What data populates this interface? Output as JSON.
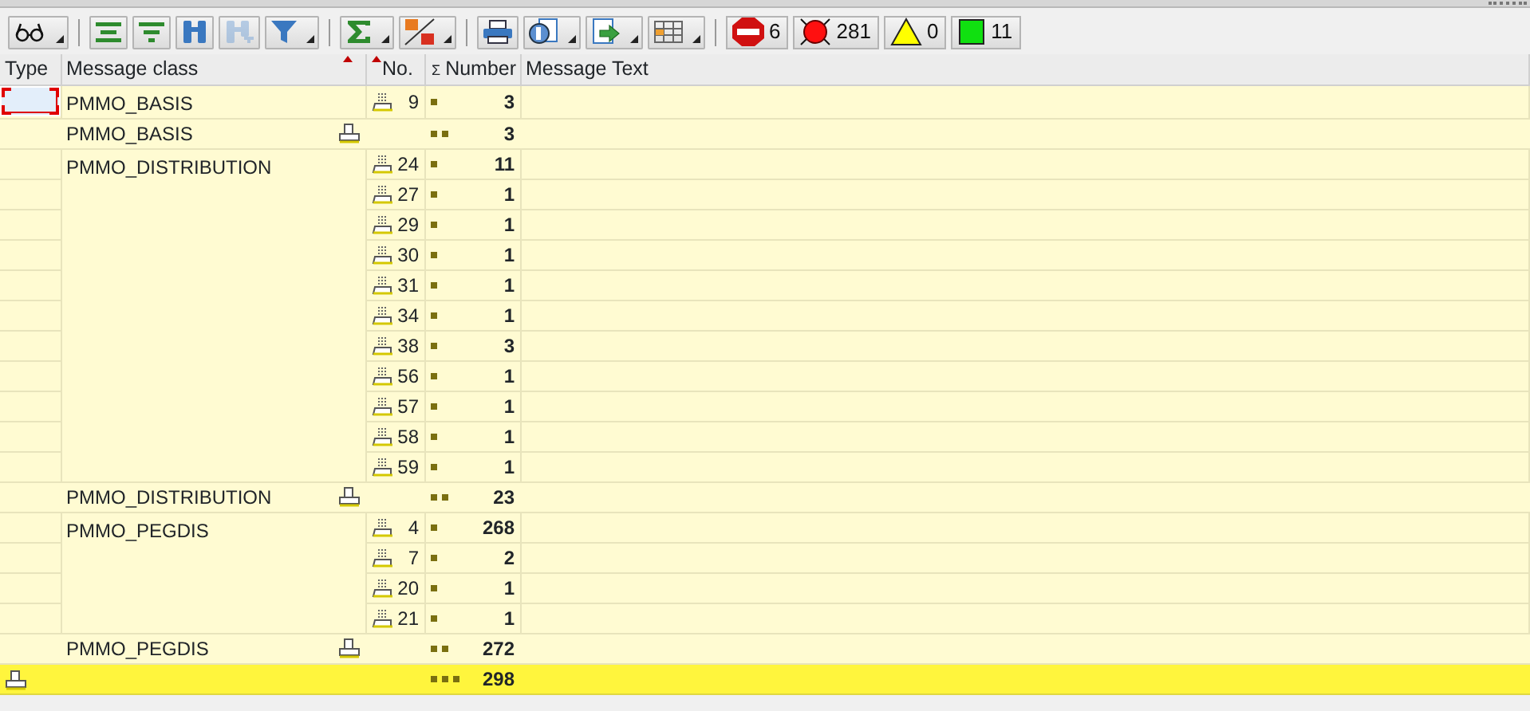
{
  "toolbar": [
    {
      "kind": "details",
      "has_menu": true,
      "disabled": false
    },
    {
      "kind": "separator"
    },
    {
      "kind": "sort-up",
      "has_menu": false,
      "disabled": false
    },
    {
      "kind": "sort-down",
      "has_menu": false,
      "disabled": false
    },
    {
      "kind": "find",
      "has_menu": false,
      "disabled": false
    },
    {
      "kind": "find-next",
      "has_menu": false,
      "disabled": true
    },
    {
      "kind": "filter",
      "has_menu": true,
      "disabled": false
    },
    {
      "kind": "separator"
    },
    {
      "kind": "sum",
      "has_menu": true,
      "disabled": false
    },
    {
      "kind": "subtotal",
      "has_menu": true,
      "disabled": false
    },
    {
      "kind": "separator"
    },
    {
      "kind": "print",
      "has_menu": false,
      "disabled": false
    },
    {
      "kind": "views",
      "has_menu": true,
      "disabled": false
    },
    {
      "kind": "export",
      "has_menu": true,
      "disabled": false
    },
    {
      "kind": "layout",
      "has_menu": true,
      "disabled": false
    },
    {
      "kind": "separator"
    }
  ],
  "counters": [
    {
      "kind": "stop",
      "count": "6"
    },
    {
      "kind": "error",
      "count": "281"
    },
    {
      "kind": "warning",
      "count": "0"
    },
    {
      "kind": "success",
      "count": "11"
    }
  ],
  "columns": [
    {
      "label": "Type",
      "kind": "text",
      "sorted": false
    },
    {
      "label": "Message class",
      "kind": "text",
      "sorted": true
    },
    {
      "label": "No.",
      "kind": "number",
      "sorted": true
    },
    {
      "label": "Number",
      "kind": "number",
      "sorted": false,
      "sum_mark": "Σ"
    },
    {
      "label": "Message Text",
      "kind": "text",
      "sorted": false
    }
  ],
  "groups": [
    {
      "message_class": "PMMO_BASIS",
      "rows": [
        {
          "no": "9",
          "number": "3",
          "selected": true
        }
      ],
      "subtotal": {
        "message_class": "PMMO_BASIS",
        "number": "3"
      }
    },
    {
      "message_class": "PMMO_DISTRIBUTION",
      "rows": [
        {
          "no": "24",
          "number": "11",
          "selected": false
        },
        {
          "no": "27",
          "number": "1",
          "selected": false
        },
        {
          "no": "29",
          "number": "1",
          "selected": false
        },
        {
          "no": "30",
          "number": "1",
          "selected": false
        },
        {
          "no": "31",
          "number": "1",
          "selected": false
        },
        {
          "no": "34",
          "number": "1",
          "selected": false
        },
        {
          "no": "38",
          "number": "3",
          "selected": false
        },
        {
          "no": "56",
          "number": "1",
          "selected": false
        },
        {
          "no": "57",
          "number": "1",
          "selected": false
        },
        {
          "no": "58",
          "number": "1",
          "selected": false
        },
        {
          "no": "59",
          "number": "1",
          "selected": false
        }
      ],
      "subtotal": {
        "message_class": "PMMO_DISTRIBUTION",
        "number": "23"
      }
    },
    {
      "message_class": "PMMO_PEGDIS",
      "rows": [
        {
          "no": "4",
          "number": "268",
          "selected": false
        },
        {
          "no": "7",
          "number": "2",
          "selected": false
        },
        {
          "no": "20",
          "number": "1",
          "selected": false
        },
        {
          "no": "21",
          "number": "1",
          "selected": false
        }
      ],
      "subtotal": {
        "message_class": "PMMO_PEGDIS",
        "number": "272"
      }
    }
  ],
  "total": {
    "number": "298"
  }
}
